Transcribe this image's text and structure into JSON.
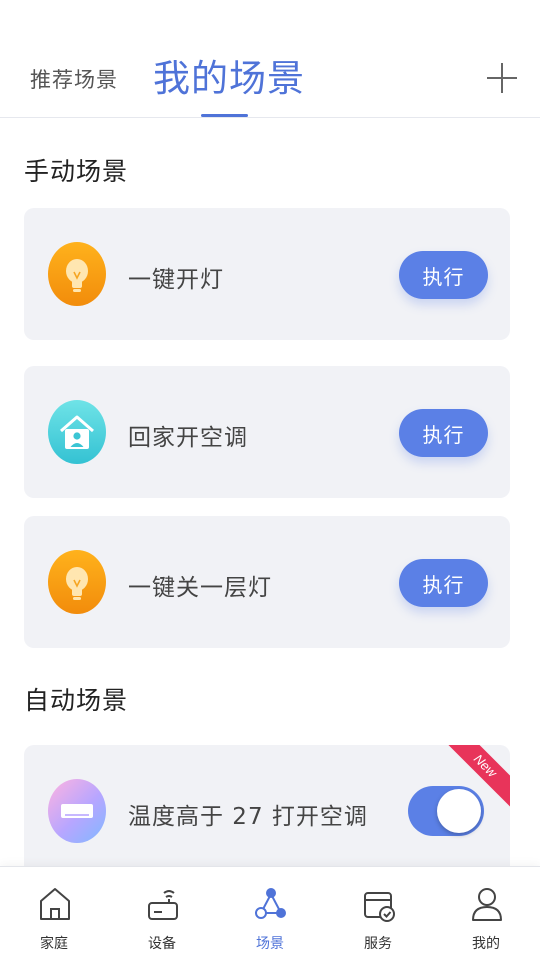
{
  "header": {
    "tabs": [
      {
        "label": "推荐场景",
        "active": false
      },
      {
        "label": "我的场景",
        "active": true
      }
    ],
    "add_icon": "plus-icon"
  },
  "manual": {
    "title": "手动场景",
    "items": [
      {
        "label": "一键开灯",
        "icon": "bulb-icon",
        "action": "执行"
      },
      {
        "label": "回家开空调",
        "icon": "home-person-icon",
        "action": "执行"
      },
      {
        "label": "一键关一层灯",
        "icon": "bulb-icon",
        "action": "执行"
      }
    ]
  },
  "auto": {
    "title": "自动场景",
    "items": [
      {
        "label": "温度高于 27 打开空调",
        "icon": "air-conditioner-icon",
        "enabled": true,
        "badge": "New"
      }
    ]
  },
  "nav": {
    "items": [
      {
        "label": "家庭",
        "icon": "house-icon",
        "active": false
      },
      {
        "label": "设备",
        "icon": "router-icon",
        "active": false
      },
      {
        "label": "场景",
        "icon": "scene-nodes-icon",
        "active": true
      },
      {
        "label": "服务",
        "icon": "service-box-icon",
        "active": false
      },
      {
        "label": "我的",
        "icon": "user-icon",
        "active": false
      }
    ]
  },
  "colors": {
    "accent": "#5b80e6",
    "bulb": "#f7a014",
    "home": "#48d0dc",
    "badge": "#e8345a"
  }
}
